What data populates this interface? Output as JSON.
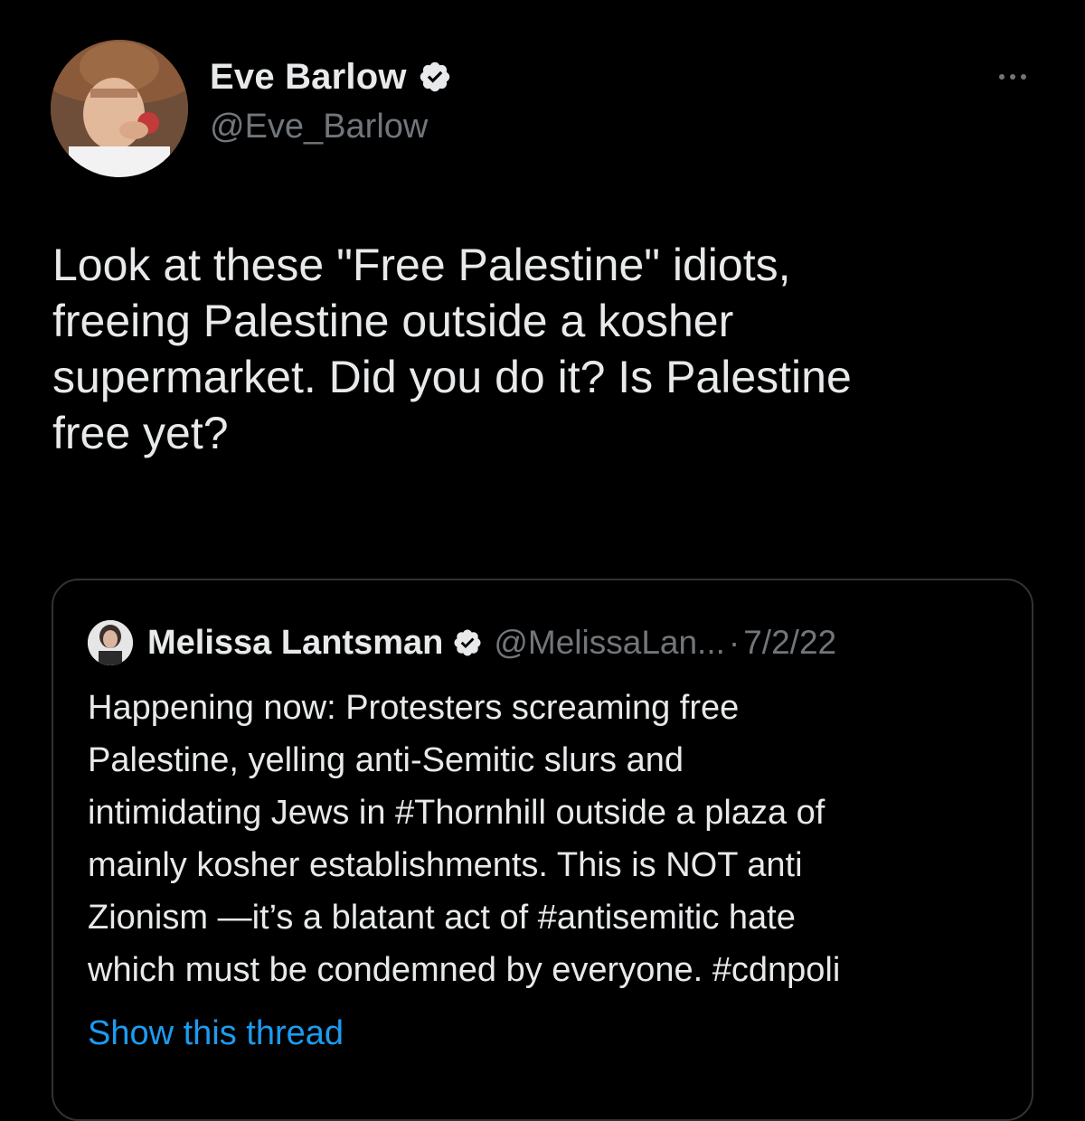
{
  "tweet": {
    "author": {
      "display_name": "Eve Barlow",
      "handle": "@Eve_Barlow",
      "verified": true,
      "avatar_icon": "avatar-photo-cowboy-hat"
    },
    "more_icon": "more-options-icon",
    "text": "Look at these \"Free Palestine\" idiots,\nfreeing Palestine outside a kosher\nsupermarket. Did you do it? Is Palestine\nfree yet?",
    "quoted": {
      "display_name": "Melissa Lantsman",
      "handle": "@MelissaLan...",
      "separator": "·",
      "date": "7/2/22",
      "verified": true,
      "text": "Happening now: Protesters screaming free\nPalestine, yelling anti-Semitic slurs and\nintimidating Jews in #Thornhill outside a plaza of\nmainly kosher establishments. This is NOT anti\nZionism —it’s a blatant act of #antisemitic hate\nwhich must be condemned by everyone. #cdnpoli",
      "show_thread_label": "Show this thread"
    }
  },
  "colors": {
    "background": "#000000",
    "primary_text": "#e7e9ea",
    "secondary_text": "#71767b",
    "link": "#1d9bf0",
    "border": "#2f3336",
    "verified_badge": "#e7e9ea"
  }
}
